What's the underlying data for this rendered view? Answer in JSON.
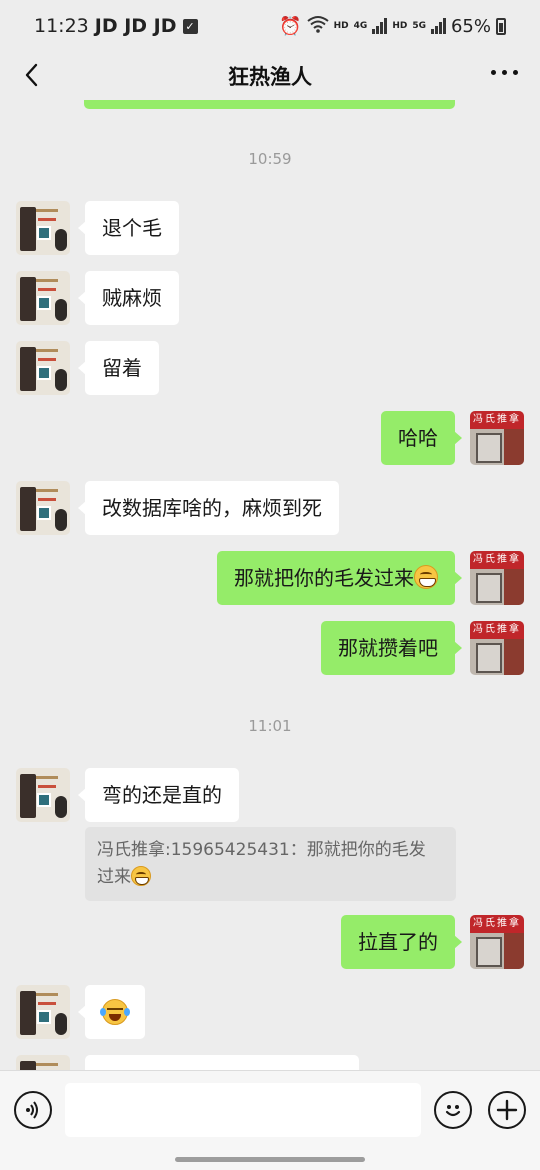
{
  "status_bar": {
    "time": "11:23",
    "carriers": "JD JD JD",
    "hd1": "HD",
    "net1": "4G",
    "hd2": "HD",
    "net2": "5G",
    "battery": "65%"
  },
  "header": {
    "title": "狂热渔人"
  },
  "chat": {
    "timestamps": [
      "10:59",
      "11:01"
    ],
    "messages": [
      {
        "side": "in",
        "text": "退个毛"
      },
      {
        "side": "in",
        "text": "贼麻烦"
      },
      {
        "side": "in",
        "text": "留着"
      },
      {
        "side": "out",
        "text": "哈哈"
      },
      {
        "side": "in",
        "text": "改数据库啥的，麻烦到死"
      },
      {
        "side": "out",
        "text": "那就把你的毛发过来",
        "emoji": "grin-emoji"
      },
      {
        "side": "out",
        "text": "那就攒着吧"
      },
      {
        "side": "in",
        "text": "弯的还是直的"
      },
      {
        "side": "out",
        "text": "拉直了的"
      },
      {
        "side": "in",
        "emoji": "laugh-cry-emoji"
      }
    ],
    "quote": {
      "line1": "冯氏推拿:15965425431：那就把你的毛发",
      "line2": "过来",
      "emoji": "grin-emoji"
    },
    "avatar_sign": "冯氏推拿"
  },
  "input_bar": {
    "placeholder": "",
    "icons": [
      "voice-icon",
      "emoji-icon",
      "plus-icon"
    ]
  },
  "colors": {
    "background": "#ededed",
    "incoming_bubble": "#ffffff",
    "outgoing_bubble": "#95ec69"
  }
}
